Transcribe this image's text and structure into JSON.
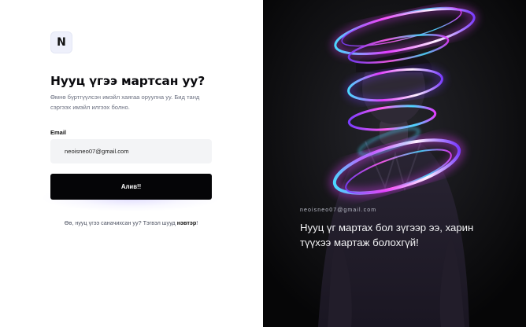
{
  "brand": {
    "logo_letter": "N"
  },
  "form": {
    "title": "Нууц үгээ мартсан уу?",
    "description": "Өмнө бүртгүүлсэн имэйл хаягаа оруулна уу. Бид танд сэргээх имэйл илгээх болно.",
    "email_label": "Email",
    "email_value": "neoisneo07@gmail.com",
    "submit_label": "Алив!!",
    "footer_text": "Өө, нууц үгээ саначихсан уу? Тэгвэл шууд ",
    "footer_link": "нэвтэр",
    "footer_end": "!"
  },
  "hero": {
    "email_caption": "neoisneo07@gmail.com",
    "quote": "Нууц үг мартах бол зүгээр ээ, харин түүхээ мартаж болохгүй!"
  },
  "colors": {
    "button_bg": "#050507",
    "input_bg": "#f3f4f6",
    "hero_bg": "#0b0b0d",
    "swirl_magenta": "#e23cff",
    "swirl_cyan": "#4ad7ff",
    "swirl_purple": "#7a3cff"
  }
}
